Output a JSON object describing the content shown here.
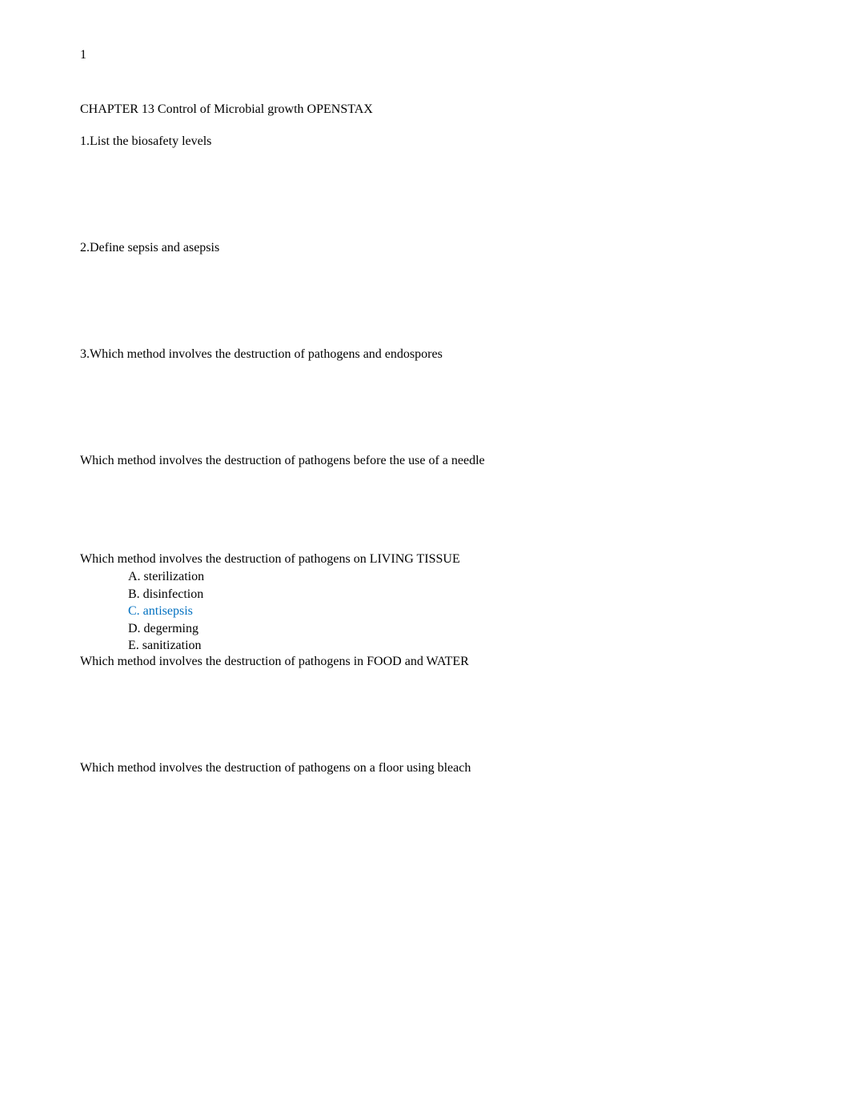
{
  "page_number": "1",
  "title": "CHAPTER 13 Control of Microbial growth OPENSTAX",
  "q1": "1.List the biosafety levels",
  "q2": "2.Define sepsis and asepsis",
  "q3": "3.Which method involves the destruction of pathogens and endospores",
  "q4": "Which method involves the destruction of pathogens before the use of a needle",
  "q5": "Which method involves the destruction of pathogens on LIVING TISSUE",
  "options": {
    "a": "A. sterilization",
    "b": "B. disinfection",
    "c": "C. antisepsis",
    "d": "D. degerming",
    "e": "E. sanitization"
  },
  "q6": "Which method involves the destruction of pathogens in FOOD and WATER",
  "q7": "Which method involves the destruction of pathogens on a floor using bleach"
}
